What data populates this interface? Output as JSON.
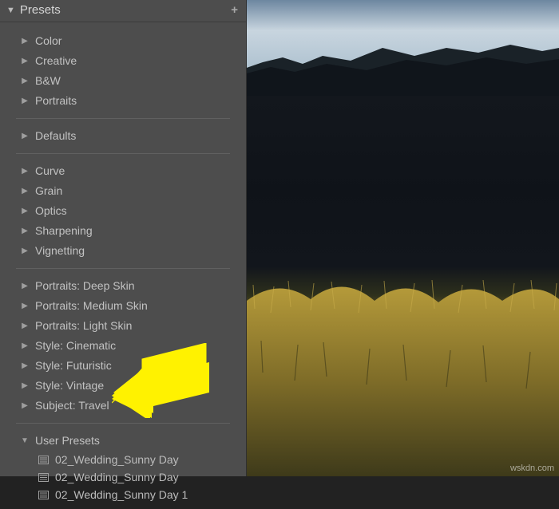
{
  "panel": {
    "title": "Presets",
    "groups": [
      {
        "items": [
          "Color",
          "Creative",
          "B&W",
          "Portraits"
        ]
      },
      {
        "items": [
          "Defaults"
        ]
      },
      {
        "items": [
          "Curve",
          "Grain",
          "Optics",
          "Sharpening",
          "Vignetting"
        ]
      },
      {
        "items": [
          "Portraits: Deep Skin",
          "Portraits: Medium Skin",
          "Portraits: Light Skin",
          "Style: Cinematic",
          "Style: Futuristic",
          "Style: Vintage",
          "Subject: Travel"
        ]
      }
    ],
    "user_presets": {
      "label": "User Presets",
      "items": [
        "02_Wedding_Sunny Day",
        "02_Wedding_Sunny Day",
        "02_Wedding_Sunny Day 1"
      ]
    }
  },
  "watermark": "wskdn.com"
}
